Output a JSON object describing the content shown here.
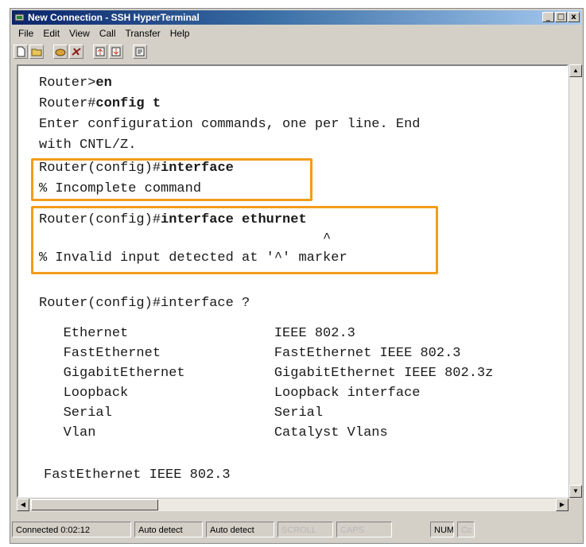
{
  "window": {
    "title": "New Connection - SSH HyperTerminal",
    "controls": [
      "_",
      "□",
      "x"
    ]
  },
  "menu": [
    "File",
    "Edit",
    "View",
    "Call",
    "Transfer",
    "Help"
  ],
  "toolbar": {
    "icons": [
      "new-icon",
      "open-icon",
      "call-icon",
      "disconnect-icon",
      "send-icon",
      "receive-icon",
      "properties-icon"
    ]
  },
  "terminal": {
    "lines": [
      {
        "prefix": "Router>",
        "bold": "en"
      },
      {
        "prefix": "Router#",
        "bold": "config t"
      },
      {
        "prefix": "Enter configuration commands, one per line. End",
        "bold": ""
      },
      {
        "prefix": "with CNTL/Z.",
        "bold": ""
      },
      {
        "prefix": "Router(config)#",
        "bold": "interface"
      },
      {
        "prefix": "% Incomplete command",
        "bold": ""
      },
      {
        "prefix": "Router(config)#",
        "bold": "interface ethurnet"
      },
      {
        "prefix": "                                   ^",
        "bold": ""
      },
      {
        "prefix": "% Invalid input detected at '^' marker",
        "bold": ""
      },
      {
        "prefix": "Router(config)#interface ?",
        "bold": ""
      },
      {
        "prefix": "   Ethernet                  IEEE 802.3",
        "bold": ""
      },
      {
        "prefix": "   FastEthernet              FastEthernet IEEE 802.3",
        "bold": ""
      },
      {
        "prefix": "   GigabitEthernet           GigabitEthernet IEEE 802.3z",
        "bold": ""
      },
      {
        "prefix": "   Loopback                  Loopback interface",
        "bold": ""
      },
      {
        "prefix": "   Serial                    Serial",
        "bold": ""
      },
      {
        "prefix": "   Vlan                      Catalyst Vlans",
        "bold": ""
      },
      {
        "prefix": "FastEthernet IEEE 802.3",
        "bold": ""
      }
    ],
    "highlight_color": "#f39c1a"
  },
  "status": {
    "connected": "Connected 0:02:12",
    "detect1": "Auto detect",
    "detect2": "Auto detect",
    "scroll": "SCROLL",
    "caps": "CAPS",
    "num": "NUM",
    "capture": "Cc"
  }
}
